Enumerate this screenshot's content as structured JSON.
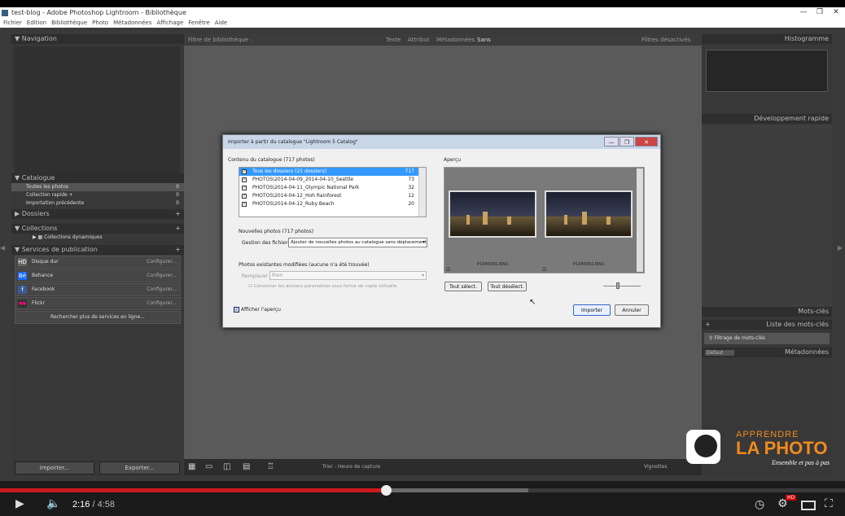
{
  "window": {
    "title": "test-blog - Adobe Photoshop Lightroom - Bibliothèque",
    "min": "—",
    "max": "❐",
    "close": "✕"
  },
  "menu": [
    "Fichier",
    "Edition",
    "Bibliothèque",
    "Photo",
    "Métadonnées",
    "Affichage",
    "Fenêtre",
    "Aide"
  ],
  "left": {
    "navigation": "Navigation",
    "catalogue": "Catalogue",
    "catalogue_items": [
      {
        "label": "Toutes les photos",
        "count": "0"
      },
      {
        "label": "Collection rapide +",
        "count": "0"
      },
      {
        "label": "Importation précédente",
        "count": "0"
      }
    ],
    "dossiers": "Dossiers",
    "collections": "Collections",
    "collections_items": [
      "Collections dynamiques"
    ],
    "publication": "Services de publication",
    "services": [
      {
        "icon": "HD",
        "label": "Disque dur",
        "cfg": "Configurer..."
      },
      {
        "icon": "Bē",
        "label": "Behance",
        "cfg": "Configurer..."
      },
      {
        "icon": "f",
        "label": "Facebook",
        "cfg": "Configurer..."
      },
      {
        "icon": "●●",
        "label": "Flickr",
        "cfg": "Configurer..."
      }
    ],
    "more_services": "Rechercher plus de services en ligne...",
    "import": "Importer...",
    "export": "Exporter..."
  },
  "center": {
    "filter_label": "Filtre de bibliothèque :",
    "filters": [
      "Texte",
      "Attribut",
      "Métadonnées",
      "Sans"
    ],
    "filters_off": "Filtres désactivés",
    "toolbar_sort": "Trier : Heure de capture"
  },
  "right": {
    "histogramme": "Histogramme",
    "dev_rapide": "Développement rapide",
    "mots_cles": "Mots-clés",
    "liste_mots_cles": "Liste des mots-clés",
    "filtrage": "Filtrage de mots-clés",
    "metadonnees": "Métadonnées",
    "default_preset": "Défaut",
    "vignette": "Vignettes"
  },
  "dialog": {
    "title": "Importer à partir du catalogue \"Lightroom 5 Catalog\"",
    "contenu": "Contenu du catalogue (717 photos)",
    "apercu": "Aperçu",
    "rows": [
      {
        "label": "Tous les dossiers (21 dossiers)",
        "count": "717",
        "sel": true
      },
      {
        "label": "PHOTOS\\2014-04-09_2014-04-10_Seattle",
        "count": "73"
      },
      {
        "label": "PHOTOS\\2014-04-11_Olympic National Park",
        "count": "32"
      },
      {
        "label": "PHOTOS\\2014-04-12_Hoh Rainforest",
        "count": "12"
      },
      {
        "label": "PHOTOS\\2014-04-12_Ruby Beach",
        "count": "20"
      }
    ],
    "nouvelles": "Nouvelles photos (717 photos)",
    "gestion_label": "Gestion des fichiers :",
    "gestion_value": "Ajouter de nouvelles photos au catalogue sans déplacement",
    "existantes": "Photos existantes modifiées (aucune n'a été trouvée)",
    "remplacer_label": "Remplacer :",
    "remplacer_value": "Rien",
    "conserver": "Conserver les anciens paramètres sous forme de copie virtuelle",
    "thumbs": [
      "P1040091.RW2",
      "P1040092.RW2"
    ],
    "tout_select": "Tout sélect.",
    "tout_deselect": "Tout désélect.",
    "afficher": "Afficher l'aperçu",
    "importer": "Importer",
    "annuler": "Annuler"
  },
  "player": {
    "current": "2:16",
    "total": " / 4:58",
    "played_fraction": 0.458,
    "buffered_fraction": 0.625,
    "hd": "HD"
  },
  "logo": {
    "line1": "APPRENDRE",
    "line2": "LA PHOTO",
    "line3": "Ensemble et pas à pas"
  }
}
